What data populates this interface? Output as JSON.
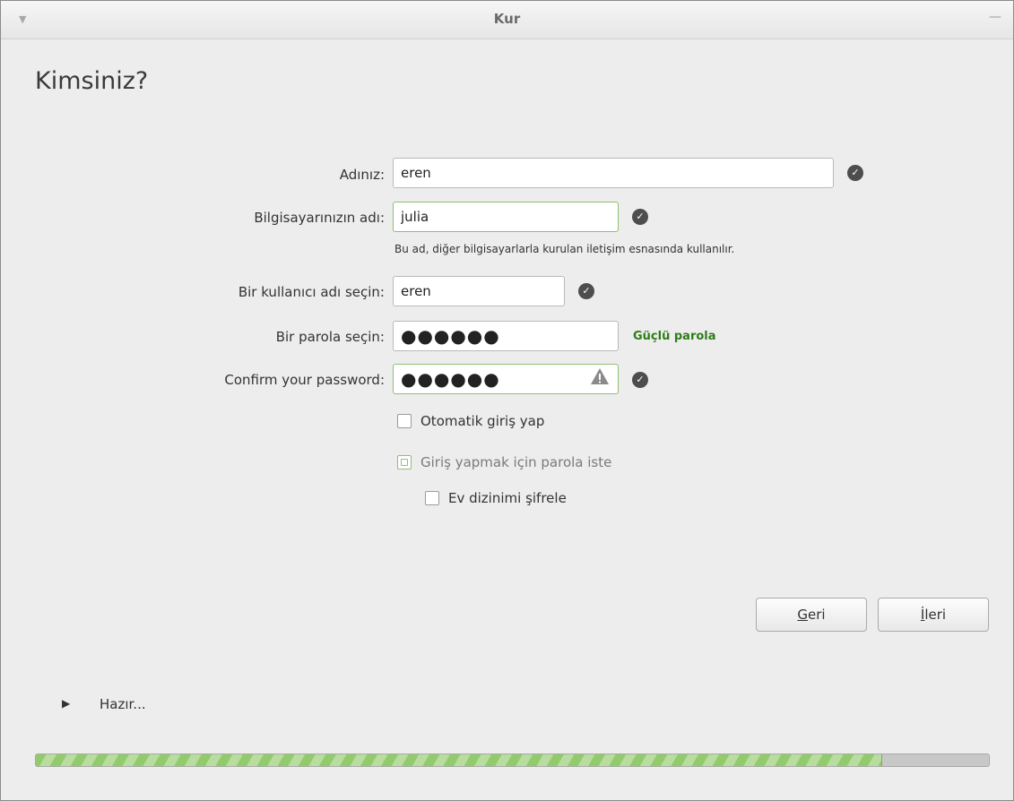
{
  "window": {
    "title": "Kur",
    "menu_icon": "chevron-down-icon",
    "minimize_icon": "minimize-icon"
  },
  "heading": "Kimsiniz?",
  "form": {
    "name": {
      "label": "Adınız:",
      "value": "eren"
    },
    "computer_name": {
      "label": "Bilgisayarınızın adı:",
      "value": "julia",
      "hint": "Bu ad, diğer bilgisayarlarla kurulan iletişim esnasında kullanılır."
    },
    "username": {
      "label": "Bir kullanıcı adı seçin:",
      "value": "eren"
    },
    "password": {
      "label": "Bir parola seçin:",
      "value": "●●●●●●",
      "strength": "Güçlü parola"
    },
    "confirm": {
      "label": "Confirm your password:",
      "value": "●●●●●●"
    }
  },
  "options": {
    "autologin": {
      "label": "Otomatik giriş yap",
      "checked": false
    },
    "require_password": {
      "label": "Giriş yapmak için parola iste",
      "checked": true
    },
    "encrypt_home": {
      "label": "Ev dizinimi şifrele",
      "checked": false
    }
  },
  "buttons": {
    "back": {
      "mnemonic": "G",
      "rest": "eri"
    },
    "next": {
      "mnemonic": "İ",
      "rest": "leri"
    }
  },
  "status": {
    "text": "Hazır...",
    "expander_icon": "triangle-right-icon"
  },
  "progress": {
    "fraction": 0.887
  },
  "colors": {
    "strength": "#2e7d18",
    "progress": "#92cb6b",
    "focus": "#8fbf6f"
  }
}
